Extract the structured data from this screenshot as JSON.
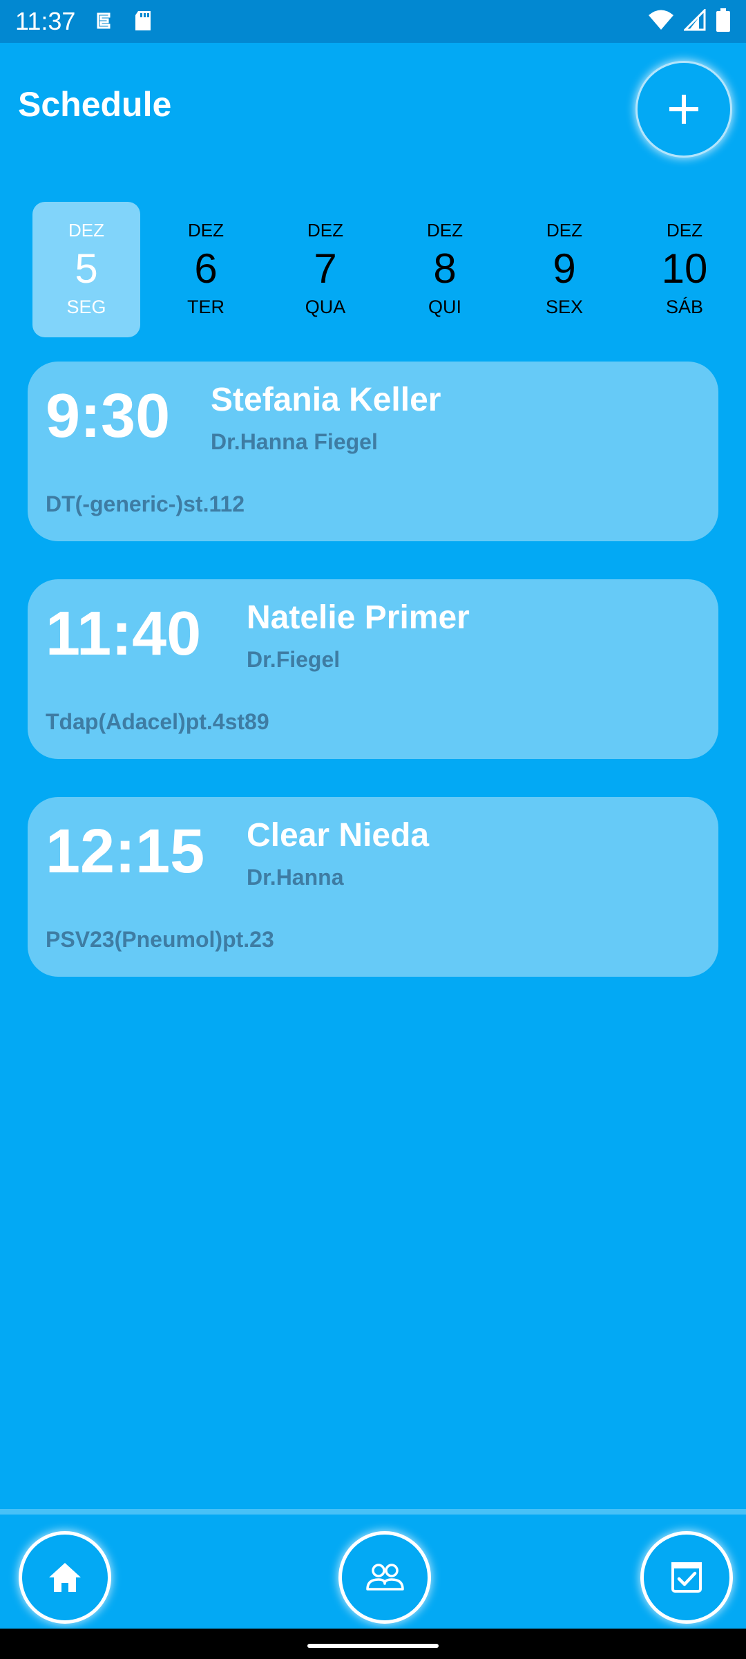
{
  "status_bar": {
    "time": "11:37"
  },
  "header": {
    "title": "Schedule"
  },
  "days": [
    {
      "month": "DEZ",
      "day": "5",
      "weekday": "SEG"
    },
    {
      "month": "DEZ",
      "day": "6",
      "weekday": "TER"
    },
    {
      "month": "DEZ",
      "day": "7",
      "weekday": "QUA"
    },
    {
      "month": "DEZ",
      "day": "8",
      "weekday": "QUI"
    },
    {
      "month": "DEZ",
      "day": "9",
      "weekday": "SEX"
    },
    {
      "month": "DEZ",
      "day": "10",
      "weekday": "SÁB"
    }
  ],
  "appointments": [
    {
      "time": "9:30",
      "patient": "Stefania Keller",
      "doctor": "Dr.Hanna Fiegel",
      "vaccine": "DT(-generic-)st.112"
    },
    {
      "time": "11:40",
      "patient": "Natelie Primer",
      "doctor": "Dr.Fiegel",
      "vaccine": "Tdap(Adacel)pt.4st89"
    },
    {
      "time": "12:15",
      "patient": "Clear Nieda",
      "doctor": "Dr.Hanna",
      "vaccine": "PSV23(Pneumol)pt.23"
    }
  ],
  "icons": {
    "add": "plus-icon",
    "nav": [
      "home-icon",
      "people-icon",
      "checklist-icon"
    ]
  },
  "colors": {
    "background": "#03A9F4",
    "card": "#66CAF7",
    "selected_day": "#81D4FA",
    "secondary_text": "#3E7CA3"
  }
}
